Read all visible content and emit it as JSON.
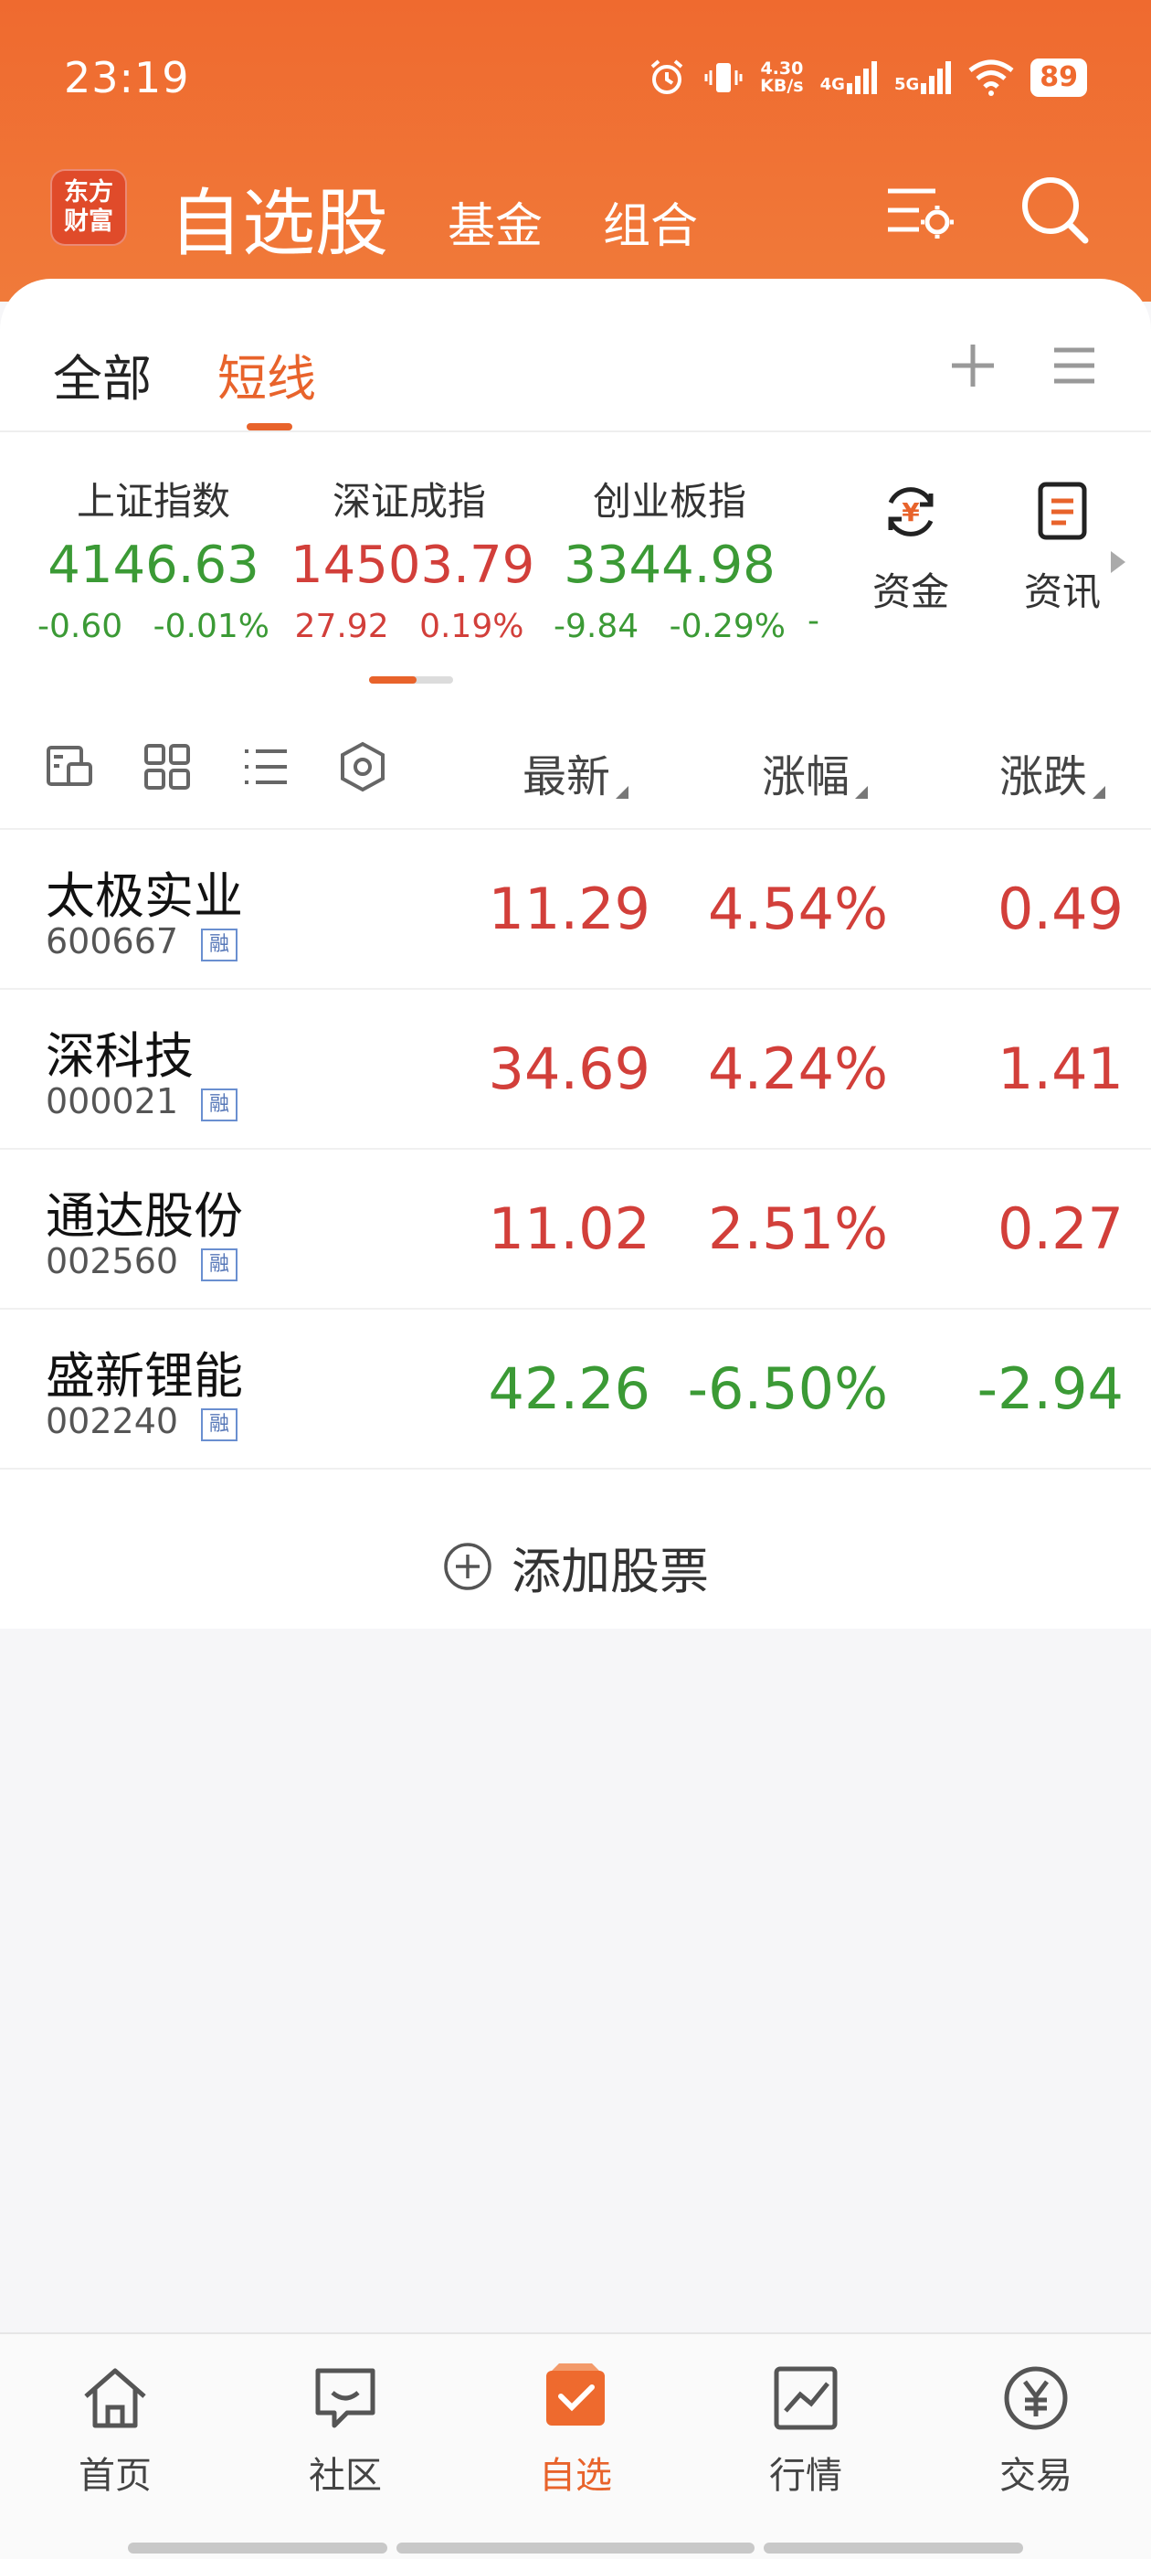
{
  "status_bar": {
    "time": "23:19",
    "net_speed_value": "4.30",
    "net_speed_unit": "KB/s",
    "sig1": "4G",
    "sig2": "5G",
    "battery": "89"
  },
  "app_bar": {
    "logo_line1": "东方",
    "logo_line2": "财富",
    "title": "自选股",
    "tab_fund": "基金",
    "tab_portfolio": "组合"
  },
  "tabs": {
    "all": "全部",
    "short": "短线"
  },
  "indices": [
    {
      "name": "上证指数",
      "value": "4146.63",
      "change": "-0.60",
      "pct": "-0.01%"
    },
    {
      "name": "深证成指",
      "value": "14503.79",
      "change": "27.92",
      "pct": "0.19%"
    },
    {
      "name": "创业板指",
      "value": "3344.98",
      "change": "-9.84",
      "pct": "-0.29%"
    }
  ],
  "index_trailing_dash": "-",
  "shortcuts": {
    "fund_flow": "资金",
    "news": "资讯"
  },
  "list_head": {
    "latest": "最新",
    "pct": "涨幅",
    "change": "涨跌"
  },
  "stocks": [
    {
      "name": "太极实业",
      "code": "600667",
      "badge": "融",
      "latest": "11.29",
      "pct": "4.54%",
      "change": "0.49"
    },
    {
      "name": "深科技",
      "code": "000021",
      "badge": "融",
      "latest": "34.69",
      "pct": "4.24%",
      "change": "1.41"
    },
    {
      "name": "通达股份",
      "code": "002560",
      "badge": "融",
      "latest": "11.02",
      "pct": "2.51%",
      "change": "0.27"
    },
    {
      "name": "盛新锂能",
      "code": "002240",
      "badge": "融",
      "latest": "42.26",
      "pct": "-6.50%",
      "change": "-2.94"
    }
  ],
  "add_stock": "添加股票",
  "bottom_nav": [
    {
      "label": "首页"
    },
    {
      "label": "社区"
    },
    {
      "label": "自选"
    },
    {
      "label": "行情"
    },
    {
      "label": "交易"
    }
  ],
  "colors": {
    "brand": "#ef6a2f",
    "up": "#d23f3a",
    "down": "#3b9a35"
  }
}
